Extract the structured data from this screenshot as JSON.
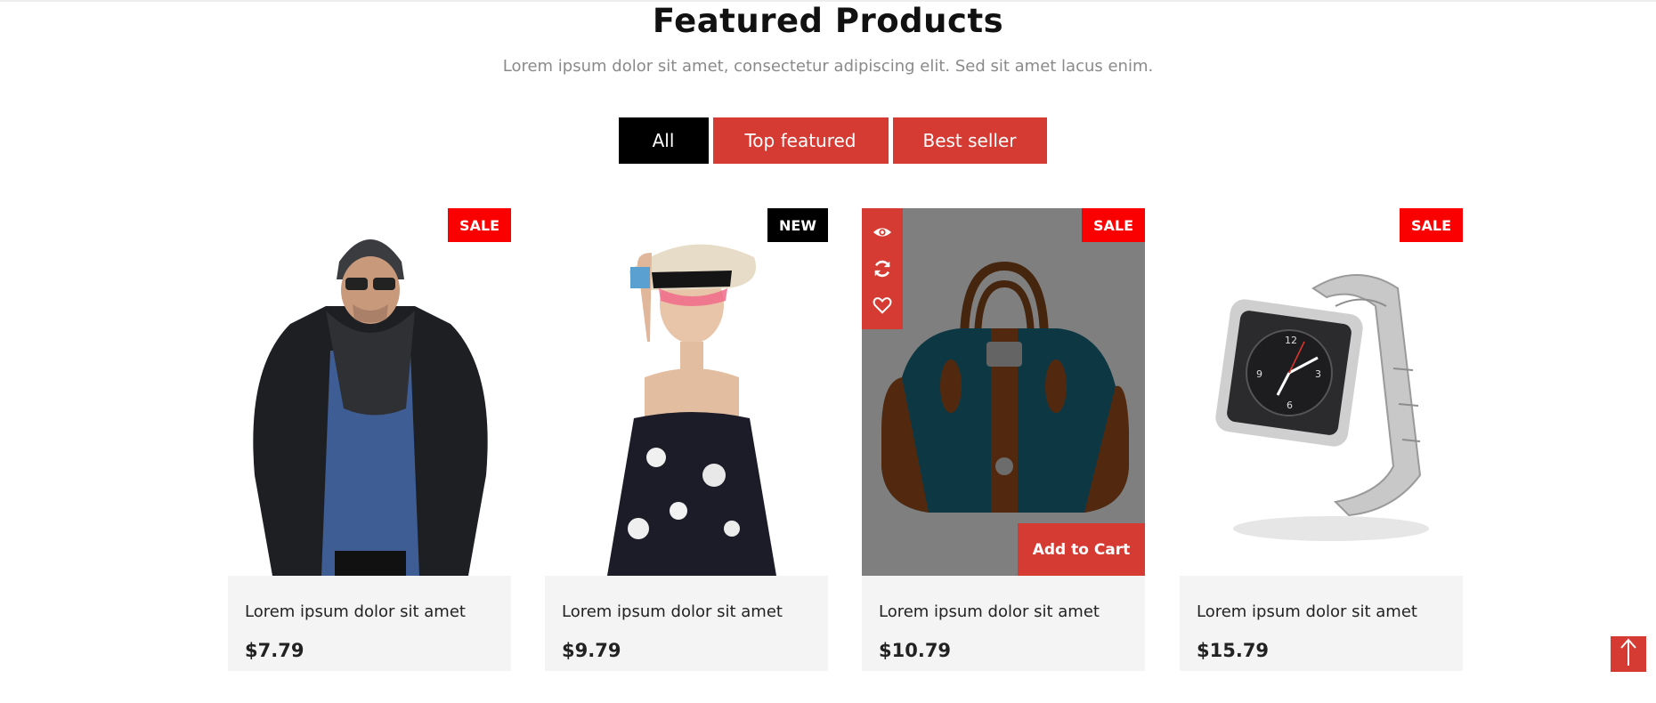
{
  "section": {
    "title": "Featured Products",
    "subtitle": "Lorem ipsum dolor sit amet, consectetur adipiscing elit. Sed sit amet lacus enim."
  },
  "filters": [
    {
      "label": "All",
      "active": true
    },
    {
      "label": "Top featured",
      "active": false
    },
    {
      "label": "Best seller",
      "active": false
    }
  ],
  "products": [
    {
      "name": "Lorem ipsum dolor sit amet",
      "price": "$7.79",
      "badge": "SALE",
      "image": "man-winter-jacket-image"
    },
    {
      "name": "Lorem ipsum dolor sit amet",
      "price": "$9.79",
      "badge": "NEW",
      "image": "woman-sun-hat-image"
    },
    {
      "name": "Lorem ipsum dolor sit amet",
      "price": "$10.79",
      "badge": "SALE",
      "image": "leather-handbag-image",
      "hovered": true,
      "add_to_cart": "Add to Cart"
    },
    {
      "name": "Lorem ipsum dolor sit amet",
      "price": "$15.79",
      "badge": "SALE",
      "image": "smart-watch-image"
    }
  ],
  "icons": {
    "quick_view": "eye-icon",
    "compare": "refresh-icon",
    "wishlist": "heart-icon",
    "back_to_top": "arrow-up-icon"
  },
  "colors": {
    "accent": "#d63b33",
    "sale_badge": "#fb0000",
    "new_badge": "#000000",
    "active_tab": "#000000",
    "info_bg": "#f4f4f4"
  }
}
